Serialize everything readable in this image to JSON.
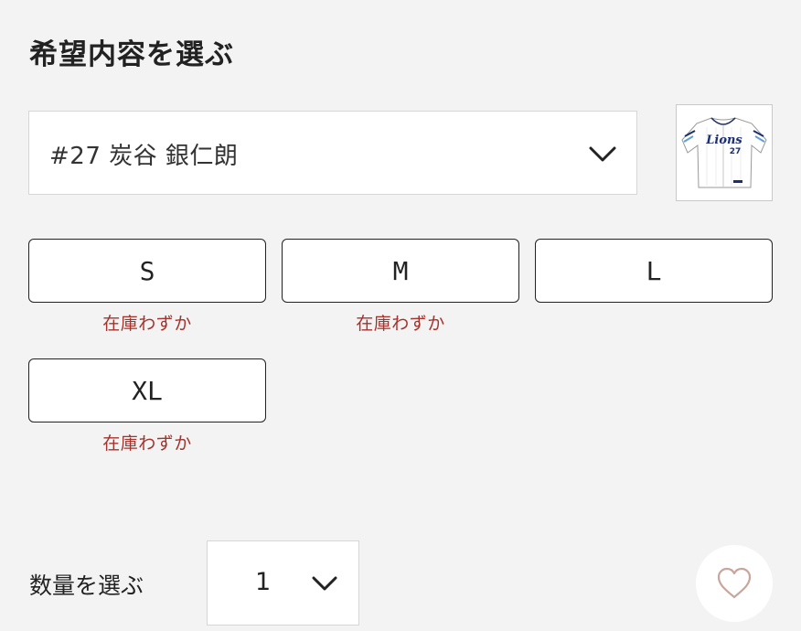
{
  "selection": {
    "title": "希望内容を選ぶ",
    "player_option": "#27 炭谷 銀仁朗",
    "thumbnail": {
      "team_text": "Lions",
      "number": "27"
    }
  },
  "sizes": [
    {
      "label": "S",
      "stock": "在庫わずか"
    },
    {
      "label": "M",
      "stock": "在庫わずか"
    },
    {
      "label": "L",
      "stock": ""
    },
    {
      "label": "XL",
      "stock": "在庫わずか"
    }
  ],
  "quantity": {
    "label": "数量を選ぶ",
    "value": "1"
  },
  "icons": {
    "dropdown": "chevron-down-icon",
    "favorite": "heart-icon",
    "product": "baseball-jersey-image"
  },
  "colors": {
    "stock_warning": "#a3332c",
    "heart": "#c8a59d",
    "jersey_navy": "#1d2f6f",
    "jersey_blue": "#5f9fd6"
  }
}
